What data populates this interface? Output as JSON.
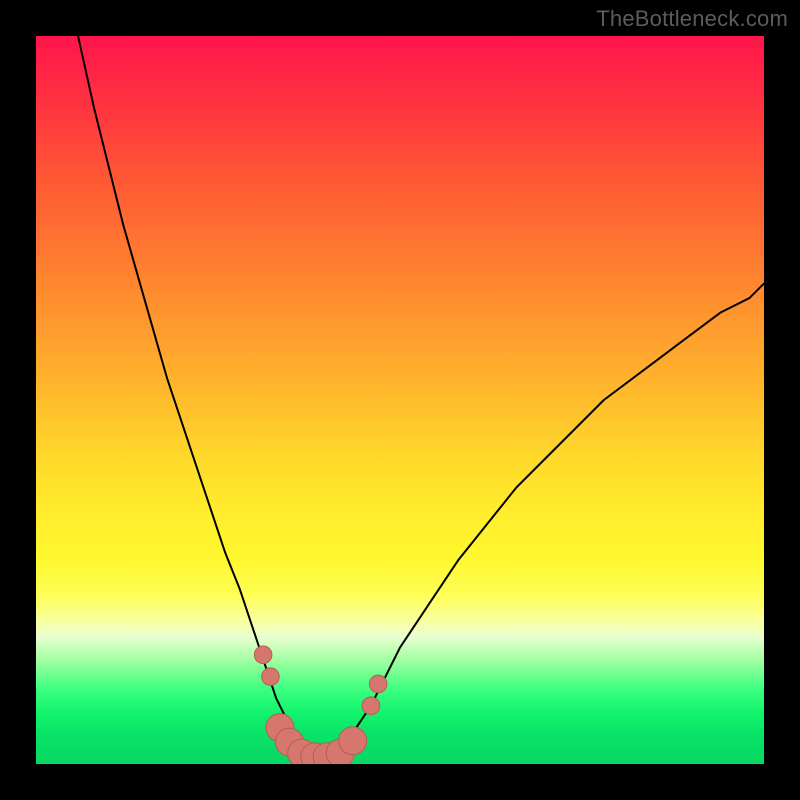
{
  "watermark": "TheBottleneck.com",
  "colors": {
    "frame": "#000000",
    "curve": "#000000",
    "markers_fill": "#d5776f",
    "markers_stroke": "#b85b53"
  },
  "chart_data": {
    "type": "line",
    "title": "",
    "xlabel": "",
    "ylabel": "",
    "xlim": [
      0,
      100
    ],
    "ylim": [
      0,
      100
    ],
    "grid": false,
    "legend": false,
    "series": [
      {
        "name": "bottleneck-curve",
        "x": [
          2,
          4,
          6,
          8,
          10,
          12,
          14,
          16,
          18,
          20,
          22,
          24,
          26,
          28,
          30,
          31,
          32,
          33,
          34,
          35,
          36,
          37,
          38,
          39,
          40,
          42,
          44,
          46,
          48,
          50,
          54,
          58,
          62,
          66,
          70,
          74,
          78,
          82,
          86,
          90,
          94,
          98,
          100
        ],
        "y": [
          118,
          108,
          99,
          90,
          82,
          74,
          67,
          60,
          53,
          47,
          41,
          35,
          29,
          24,
          18,
          15,
          12,
          9,
          7,
          5,
          3,
          2,
          1,
          1,
          1,
          2,
          5,
          8,
          12,
          16,
          22,
          28,
          33,
          38,
          42,
          46,
          50,
          53,
          56,
          59,
          62,
          64,
          66
        ]
      }
    ],
    "markers": [
      {
        "x": 31.2,
        "y": 15.0,
        "r": 1.2
      },
      {
        "x": 32.2,
        "y": 12.0,
        "r": 1.2
      },
      {
        "x": 33.5,
        "y": 5.0,
        "r": 2.5
      },
      {
        "x": 34.8,
        "y": 3.0,
        "r": 2.5
      },
      {
        "x": 36.5,
        "y": 1.5,
        "r": 2.5
      },
      {
        "x": 38.3,
        "y": 1.0,
        "r": 2.5
      },
      {
        "x": 40.0,
        "y": 1.0,
        "r": 2.5
      },
      {
        "x": 41.8,
        "y": 1.5,
        "r": 2.5
      },
      {
        "x": 43.5,
        "y": 3.2,
        "r": 2.5
      },
      {
        "x": 46.0,
        "y": 8.0,
        "r": 1.2
      },
      {
        "x": 47.0,
        "y": 11.0,
        "r": 1.2
      }
    ]
  }
}
